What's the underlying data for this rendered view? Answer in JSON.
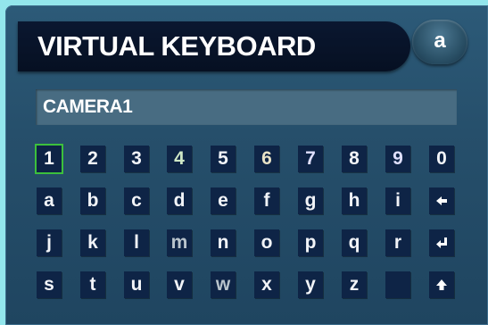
{
  "header": {
    "title": "VIRTUAL KEYBOARD",
    "case_toggle_label": "a"
  },
  "input": {
    "value": "CAMERA1"
  },
  "keyboard": {
    "selected_key": "1",
    "rows": [
      [
        "1",
        "2",
        "3",
        "4",
        "5",
        "6",
        "7",
        "8",
        "9",
        "0"
      ],
      [
        "a",
        "b",
        "c",
        "d",
        "e",
        "f",
        "g",
        "h",
        "i",
        "backspace"
      ],
      [
        "j",
        "k",
        "l",
        "m",
        "n",
        "o",
        "p",
        "q",
        "r",
        "enter"
      ],
      [
        "s",
        "t",
        "u",
        "v",
        "w",
        "x",
        "y",
        "z",
        "",
        "shift"
      ]
    ],
    "icons": {
      "backspace": "left-arrow-icon",
      "enter": "return-arrow-icon",
      "shift": "up-arrow-icon"
    }
  },
  "colors": {
    "background": "#93e6ec",
    "panel": "#264f6b",
    "title_bar": "#061022",
    "key_background": "#0e2446",
    "selection": "#3cc03c"
  }
}
